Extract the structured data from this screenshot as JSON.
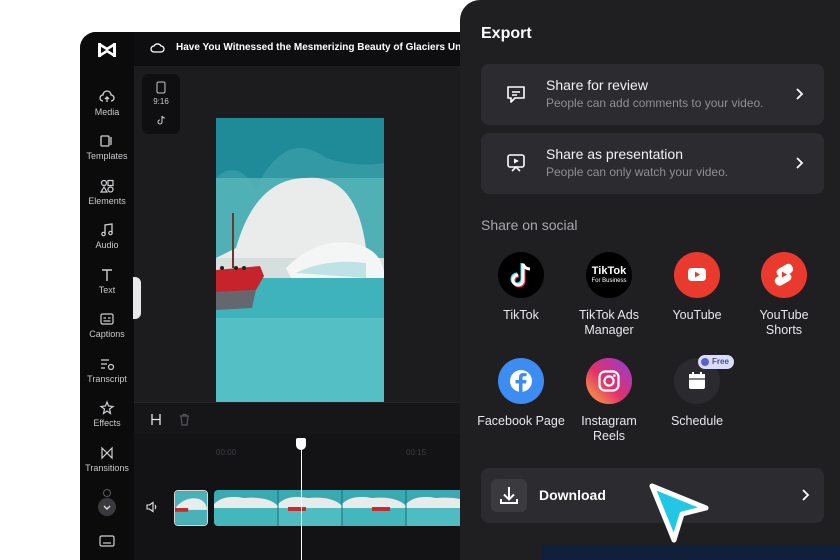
{
  "editor": {
    "title": "Have You Witnessed the Mesmerizing Beauty of Glaciers Une",
    "aspect_ratio": "9:16",
    "rail": [
      {
        "label": "Media",
        "icon": "cloud-upload-icon"
      },
      {
        "label": "Templates",
        "icon": "templates-icon"
      },
      {
        "label": "Elements",
        "icon": "elements-icon"
      },
      {
        "label": "Audio",
        "icon": "music-note-icon"
      },
      {
        "label": "Text",
        "icon": "text-icon"
      },
      {
        "label": "Captions",
        "icon": "captions-icon"
      },
      {
        "label": "Transcript",
        "icon": "transcript-icon"
      },
      {
        "label": "Effects",
        "icon": "effects-icon"
      },
      {
        "label": "Transitions",
        "icon": "transitions-icon"
      }
    ],
    "ruler": [
      "00:00",
      "00:15"
    ]
  },
  "export": {
    "title": "Export",
    "share_review": {
      "title": "Share for review",
      "desc": "People can add comments to your video."
    },
    "share_presentation": {
      "title": "Share as presentation",
      "desc": "People can only watch your video."
    },
    "social_label": "Share on social",
    "social": [
      {
        "label": "TikTok",
        "icon": "tiktok-icon",
        "color": "#000000"
      },
      {
        "label": "TikTok Ads Manager",
        "icon": "tiktok-business-icon",
        "color": "#000000",
        "logo_text": "TikTok",
        "logo_sub": "For Business"
      },
      {
        "label": "YouTube",
        "icon": "youtube-icon",
        "color": "#ea3a2e"
      },
      {
        "label": "YouTube Shorts",
        "icon": "youtube-shorts-icon",
        "color": "#ea3a2e"
      },
      {
        "label": "Facebook Page",
        "icon": "facebook-icon",
        "color": "#3d8cf2"
      },
      {
        "label": "Instagram Reels",
        "icon": "instagram-icon",
        "color": "#e3306c"
      },
      {
        "label": "Schedule",
        "icon": "calendar-icon",
        "color": "#2b2b2f"
      }
    ],
    "free_badge": "Free",
    "download": "Download"
  },
  "colors": {
    "panel": "#1f1f22",
    "card": "#2c2c30",
    "accent_cursor": "#22c7e6"
  }
}
